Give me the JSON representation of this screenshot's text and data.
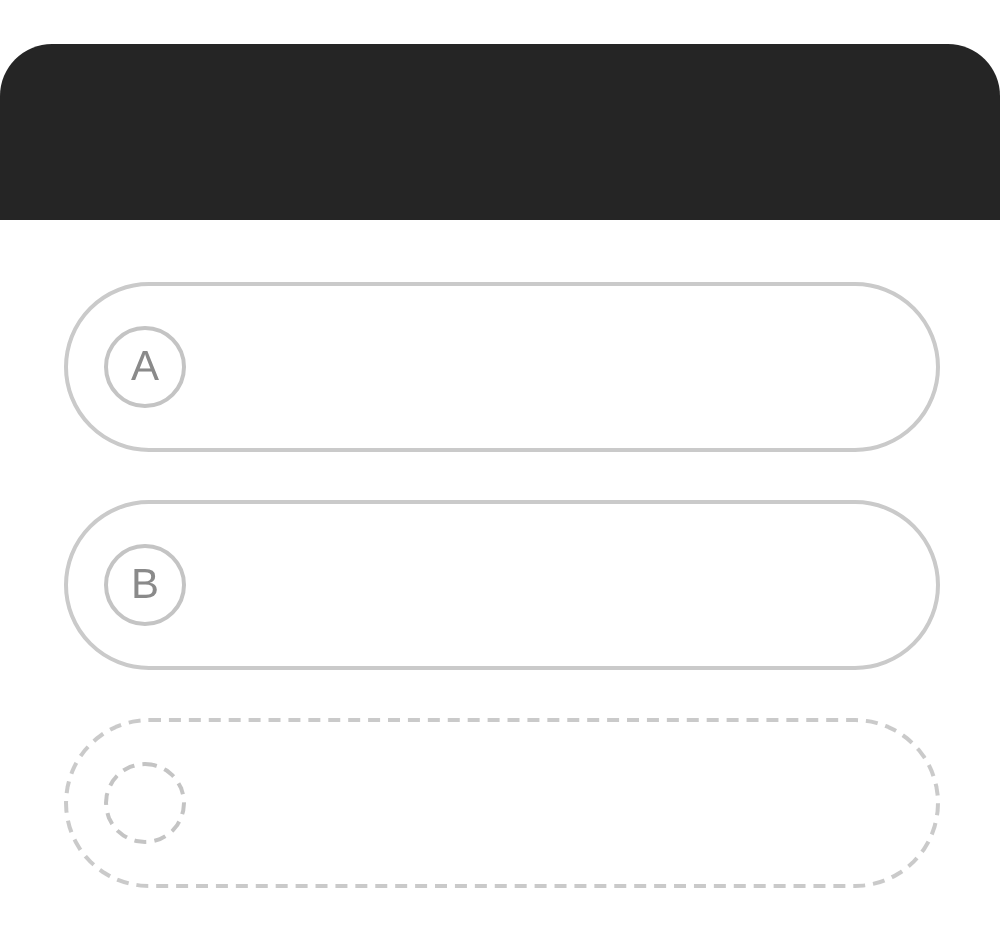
{
  "options": [
    {
      "kind": "answer",
      "letter": "A"
    },
    {
      "kind": "answer",
      "letter": "B"
    },
    {
      "kind": "placeholder"
    }
  ]
}
